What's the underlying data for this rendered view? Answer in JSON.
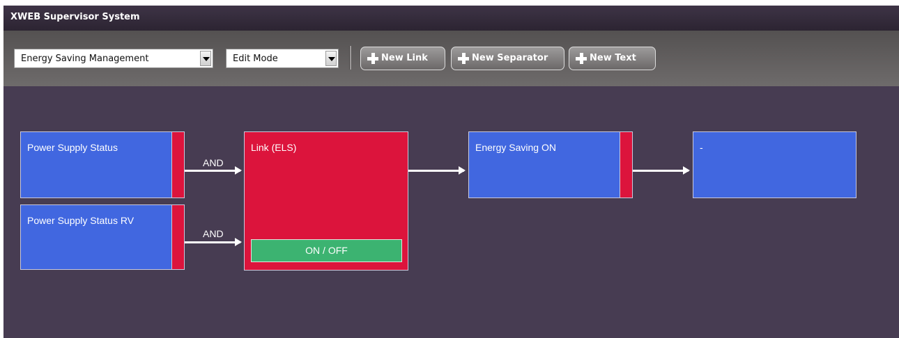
{
  "app": {
    "title": "XWEB Supervisor System"
  },
  "toolbar": {
    "view_select": {
      "value": "Energy Saving Management"
    },
    "mode_select": {
      "value": "Edit Mode"
    },
    "buttons": {
      "new_link": "New Link",
      "new_separator": "New Separator",
      "new_text": "New Text"
    }
  },
  "diagram": {
    "nodes": {
      "power_supply_status": "Power Supply Status",
      "power_supply_status_rv": "Power Supply Status RV",
      "link": "Link (ELS)",
      "link_toggle": "ON / OFF",
      "energy_saving_on": "Energy Saving ON",
      "output": "-"
    },
    "connectors": {
      "and_1": "AND",
      "and_2": "AND"
    }
  },
  "colors": {
    "canvas_bg": "#473c52",
    "node_blue": "#4167e0",
    "node_red": "#dc143c",
    "toggle_green": "#3cb371"
  }
}
